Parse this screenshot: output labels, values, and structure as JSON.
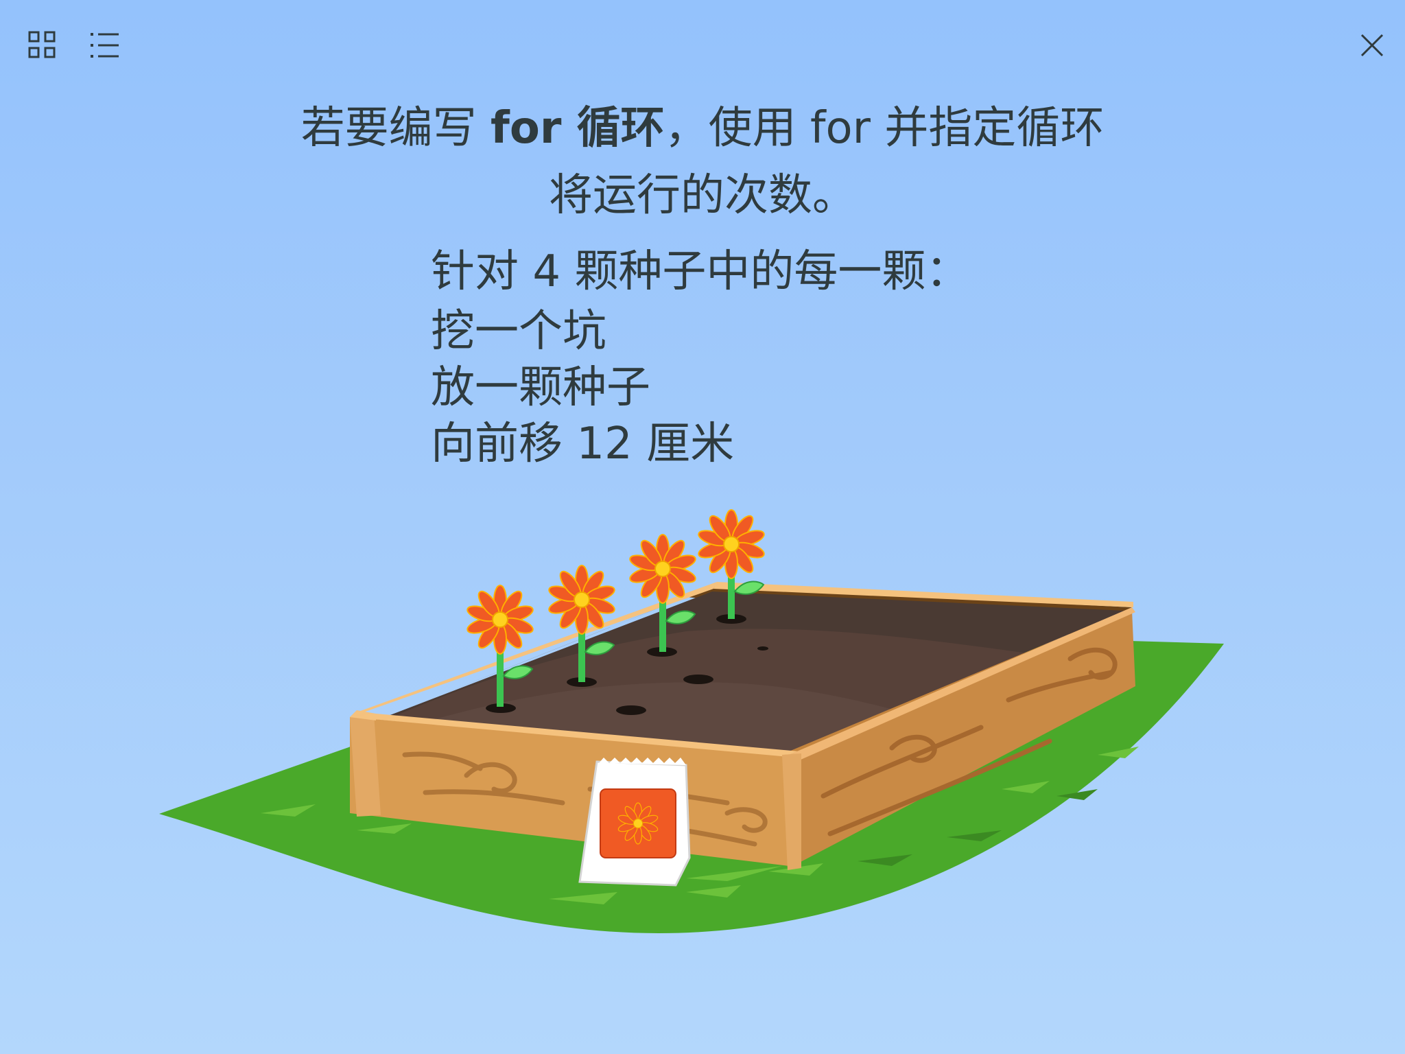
{
  "toolbar": {
    "grid_icon": "grid-icon",
    "list_icon": "list-icon",
    "close_icon": "close-icon"
  },
  "heading": {
    "part1": "若要编写 ",
    "bold": "for 循环",
    "part2": "，使用 for 并指定循环",
    "line2": "将运行的次数。"
  },
  "steps": {
    "intro": "针对 4 颗种子中的每一颗：",
    "items": [
      "挖一个坑",
      "放一颗种子",
      "向前移 12 厘米"
    ]
  },
  "illustration": {
    "subject": "raised-garden-bed",
    "flowers": 4,
    "seed_packet": true
  },
  "colors": {
    "background_top": "#94c2fc",
    "background_bottom": "#b3d7fc",
    "text": "#2f3b3e",
    "grass": "#4aa92a",
    "wood": "#d99c52",
    "soil": "#4a3a33",
    "petal": "#f05a24",
    "flower_center": "#ffd21f",
    "stem": "#3cc451"
  }
}
